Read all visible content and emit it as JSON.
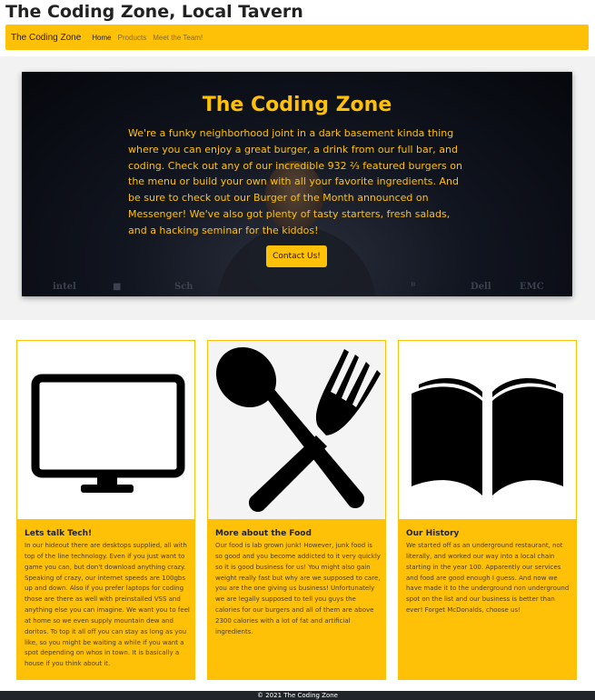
{
  "site": {
    "title": "The Coding Zone, Local Tavern"
  },
  "navbar": {
    "brand": "The Coding Zone",
    "links": [
      {
        "label": "Home",
        "active": true
      },
      {
        "label": "Products",
        "active": false
      },
      {
        "label": "Meet the Team!",
        "active": false
      }
    ]
  },
  "hero": {
    "title": "The Coding Zone",
    "text": "We're a funky neighborhood joint in a dark basement kinda thing where you can enjoy a great burger, a drink from our full bar, and coding. Check out any of our incredible 932 ⅔ featured burgers on the menu or build your own with all your favorite ingredients. And be sure to check out our Burger of the Month announced on Messenger! We've also got plenty of tasty starters, fresh salads, and a hacking seminar for the kiddos!",
    "button_label": "Contact Us!",
    "logos": [
      "intel",
      "■",
      "Sch",
      "ᴮ",
      "Dell",
      "EMC"
    ]
  },
  "cards": [
    {
      "icon": "monitor-icon",
      "title": "Lets talk Tech!",
      "text": "In our hideout there are desktops supplied, all with top of the line technology. Even if you just want to game you can, but don't download anything crazy. Speaking of crazy, our internet speeds are 100gbs up and down. Also if you prefer laptops for coding those are there as well with preinstalled VSS and anything else you can imagine. We want you to feel at home so we even supply mountain dew and doritos. To top it all off you can stay as long as you like, so you might be waiting a while if you want a spot depending on whos in town. It is basically a house if you think about it."
    },
    {
      "icon": "fork-spoon-icon",
      "title": "More about the Food",
      "text": "Our food is lab grown junk! However, junk food is so good and you become addicted to it very quickly so it is good business for us! You might also gain weight really fast but why are we supposed to care, you are the one giving us business! Unfortunately we are legally supposed to tell you guys the calories for our burgers and all of them are above 2300 calories with a lot of fat and artificial ingredients."
    },
    {
      "icon": "open-book-icon",
      "title": "Our History",
      "text": "We started off as an underground restaurant, not literally, and worked our way into a local chain starting in the year 100. Apparently our services and food are good enough I guess. And now we have made it to the underground non underground spot on the list and our business is better than ever! Forget McDonalds, choose us!"
    }
  ],
  "footer": {
    "text": "© 2021 The Coding Zone"
  },
  "colors": {
    "accent": "#ffc107",
    "footer_bg": "#212529"
  }
}
